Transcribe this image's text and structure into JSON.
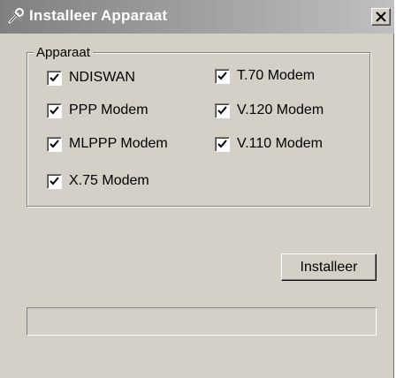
{
  "window": {
    "title": "Installeer Apparaat",
    "title_icon": "tools-icon",
    "close_icon": "close-icon"
  },
  "group": {
    "legend": "Apparaat",
    "items": [
      {
        "label": "NDISWAN",
        "checked": true
      },
      {
        "label": "PPP Modem",
        "checked": true
      },
      {
        "label": "MLPPP Modem",
        "checked": true
      },
      {
        "label": "X.75 Modem",
        "checked": true
      },
      {
        "label": "T.70 Modem",
        "checked": true
      },
      {
        "label": "V.120 Modem",
        "checked": true
      },
      {
        "label": "V.110 Modem",
        "checked": true
      }
    ]
  },
  "buttons": {
    "install_label": "Installeer"
  },
  "status": {
    "text": ""
  },
  "colors": {
    "face": "#d4d0c8",
    "title_gradient_start": "#808080",
    "title_gradient_end": "#c0c0c0"
  }
}
